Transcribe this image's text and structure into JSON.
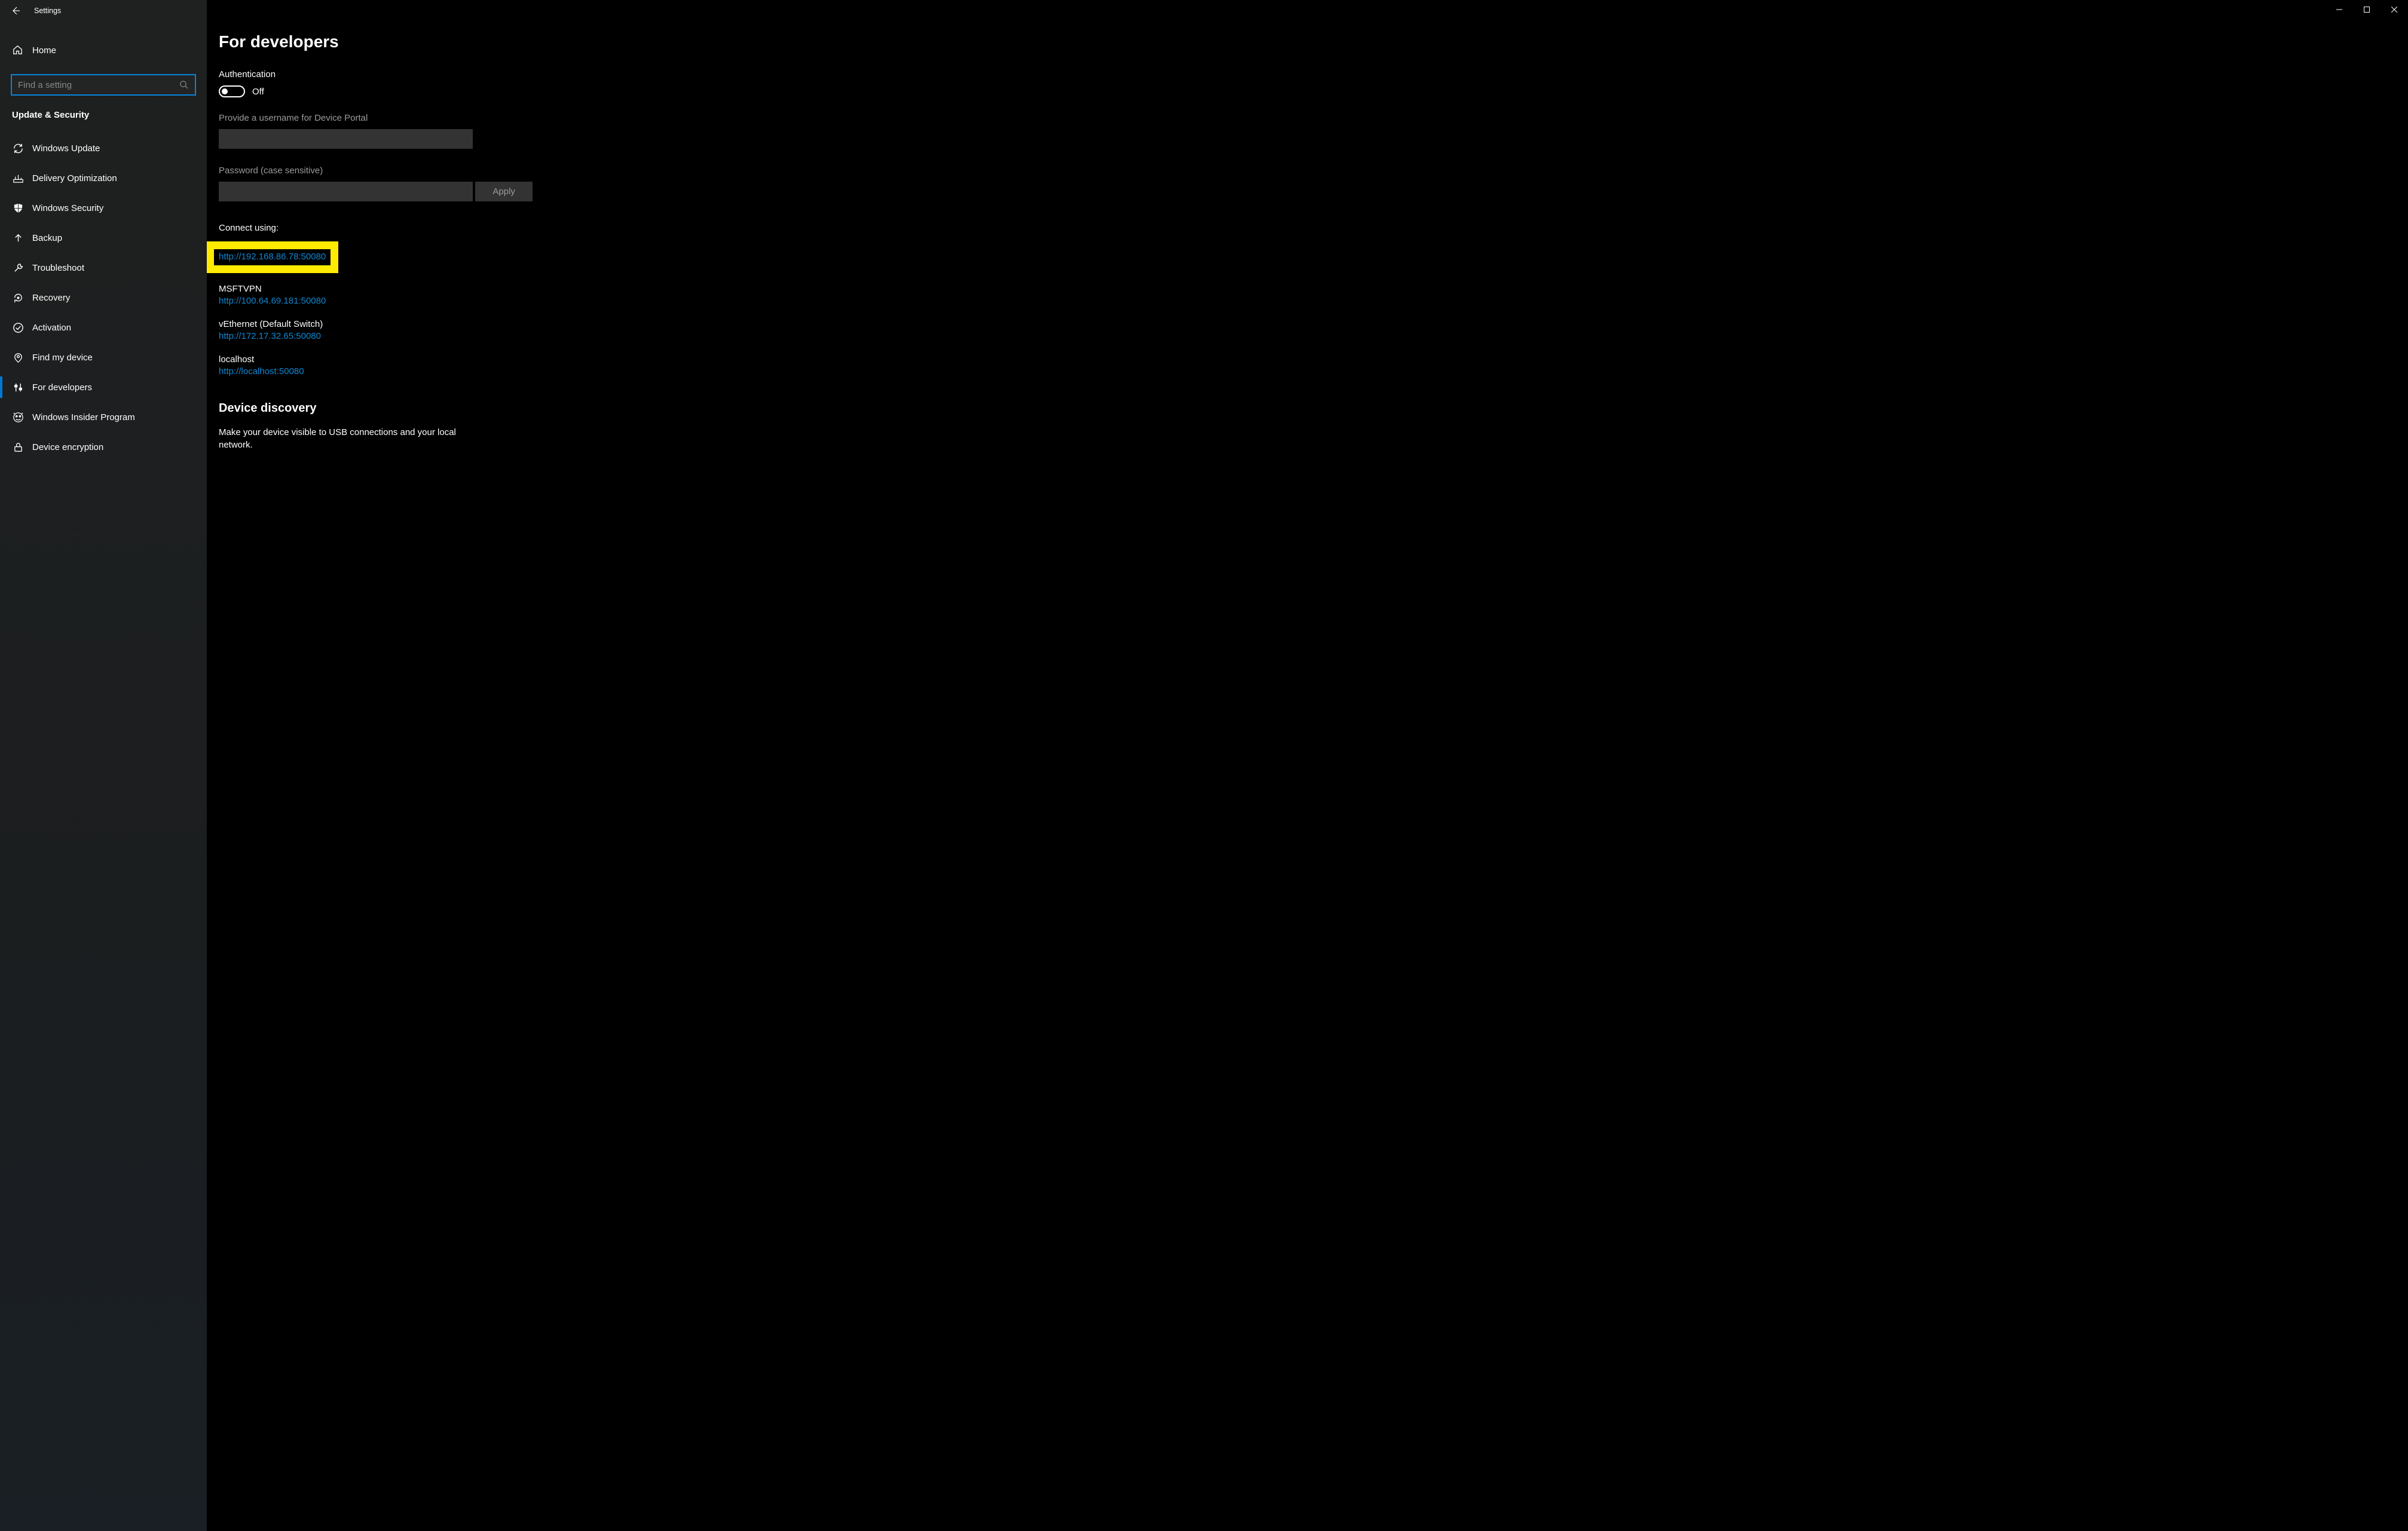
{
  "app_title": "Settings",
  "sidebar": {
    "home_label": "Home",
    "search_placeholder": "Find a setting",
    "section_title": "Update & Security",
    "items": [
      {
        "label": "Windows Update"
      },
      {
        "label": "Delivery Optimization"
      },
      {
        "label": "Windows Security"
      },
      {
        "label": "Backup"
      },
      {
        "label": "Troubleshoot"
      },
      {
        "label": "Recovery"
      },
      {
        "label": "Activation"
      },
      {
        "label": "Find my device"
      },
      {
        "label": "For developers"
      },
      {
        "label": "Windows Insider Program"
      },
      {
        "label": "Device encryption"
      }
    ]
  },
  "main": {
    "title": "For developers",
    "auth_heading": "Authentication",
    "auth_toggle_state": "Off",
    "username_label": "Provide a username for Device Portal",
    "password_label": "Password (case sensitive)",
    "apply_label": "Apply",
    "connect_label": "Connect using:",
    "connections": [
      {
        "name": "",
        "url": "http://192.168.86.78:50080",
        "highlighted": true
      },
      {
        "name": "MSFTVPN",
        "url": "http://100.64.69.181:50080"
      },
      {
        "name": "vEthernet (Default Switch)",
        "url": "http://172.17.32.65:50080"
      },
      {
        "name": "localhost",
        "url": "http://localhost:50080"
      }
    ],
    "device_discovery_heading": "Device discovery",
    "device_discovery_desc": "Make your device visible to USB connections and your local network."
  }
}
